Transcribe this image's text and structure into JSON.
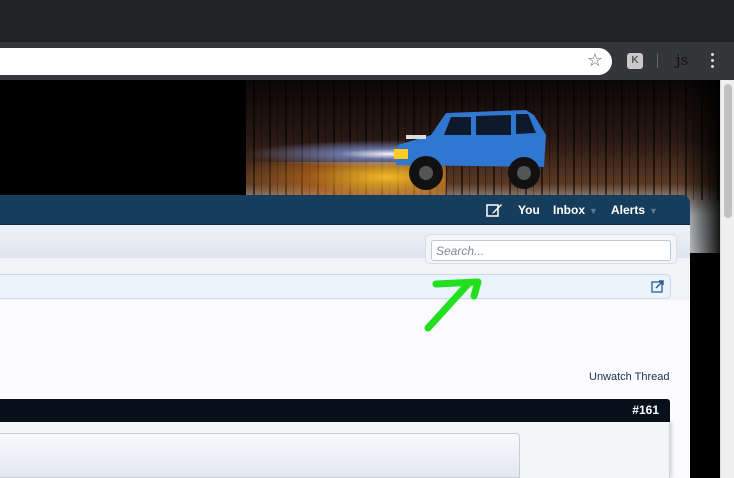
{
  "browser": {
    "star_glyph": "☆",
    "extension_k_label": "K",
    "extension_js_label": "js"
  },
  "nav": {
    "items": [
      {
        "label": "You",
        "has_arrow": false
      },
      {
        "label": "Inbox",
        "has_arrow": true
      },
      {
        "label": "Alerts",
        "has_arrow": true
      }
    ],
    "arrow_glyph": "▼"
  },
  "search": {
    "placeholder": "Search..."
  },
  "thread": {
    "unwatch_label": "Unwatch Thread",
    "post_number": "#161"
  },
  "colors": {
    "navbar": "#173d5c",
    "annotation_arrow": "#22e01e"
  }
}
